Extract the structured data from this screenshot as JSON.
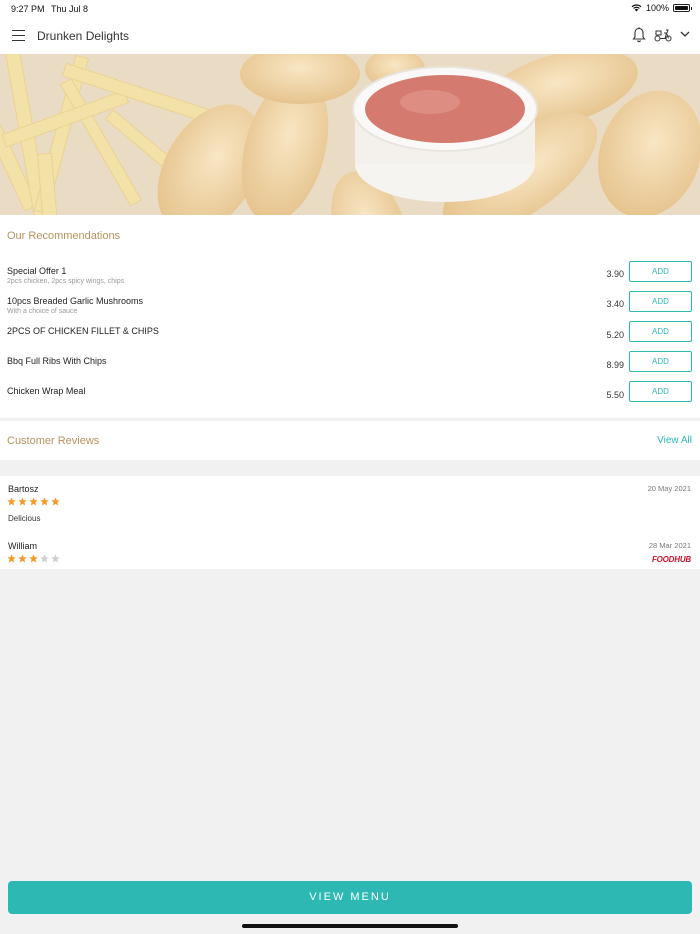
{
  "status_bar": {
    "time": "9:27 PM",
    "date": "Thu Jul 8",
    "battery": "100%"
  },
  "header": {
    "title": "Drunken Delights"
  },
  "recommendations": {
    "title": "Our Recommendations",
    "items": [
      {
        "name": "Special Offer 1",
        "description": "2pcs chicken, 2pcs spicy wings, chips",
        "price": "3.90",
        "button": "ADD"
      },
      {
        "name": "10pcs Breaded Garlic Mushrooms",
        "description": "With a choice of sauce",
        "price": "3.40",
        "button": "ADD"
      },
      {
        "name": "2PCS OF CHICKEN FILLET & CHIPS",
        "description": "",
        "price": "5.20",
        "button": "ADD"
      },
      {
        "name": "Bbq Full Ribs With Chips",
        "description": "",
        "price": "8.99",
        "button": "ADD"
      },
      {
        "name": "Chicken Wrap Meal",
        "description": "",
        "price": "5.50",
        "button": "ADD"
      }
    ]
  },
  "reviews": {
    "title": "Customer Reviews",
    "view_all": "View All",
    "items": [
      {
        "name": "Bartosz",
        "date": "20 May 2021",
        "rating": 5,
        "text": "Delicious",
        "source": ""
      },
      {
        "name": "William",
        "date": "28 Mar 2021",
        "rating": 3,
        "text": "",
        "source": "FOODHUB"
      }
    ]
  },
  "footer": {
    "view_menu": "VIEW MENU"
  },
  "colors": {
    "accent": "#2eb8b3",
    "section_title": "#b8925c",
    "star_on": "#f39a2b",
    "star_off": "#cfcfcf",
    "brand_logo": "#d0142c"
  }
}
